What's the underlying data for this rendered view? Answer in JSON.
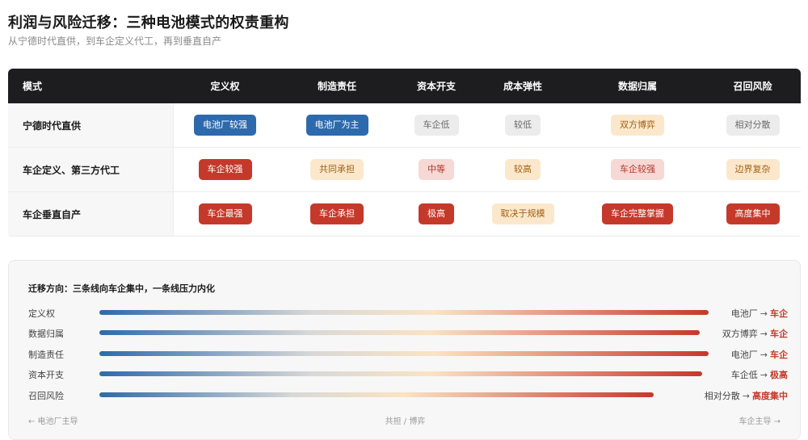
{
  "header": {
    "title": "利润与风险迁移：三种电池模式的权责重构",
    "subtitle": "从宁德时代直供，到车企定义代工，再到垂直自产"
  },
  "matrix": {
    "columns": [
      "模式",
      "定义权",
      "制造责任",
      "资本开支",
      "成本弹性",
      "数据归属",
      "召回风险"
    ],
    "rows": [
      {
        "label": "宁德时代直供",
        "cells": [
          {
            "text": "电池厂较强",
            "tone": "strong-blue"
          },
          {
            "text": "电池厂为主",
            "tone": "strong-blue"
          },
          {
            "text": "车企低",
            "tone": "soft-gray"
          },
          {
            "text": "较低",
            "tone": "soft-gray"
          },
          {
            "text": "双方博弈",
            "tone": "soft-amber"
          },
          {
            "text": "相对分散",
            "tone": "soft-gray"
          }
        ]
      },
      {
        "label": "车企定义、第三方代工",
        "cells": [
          {
            "text": "车企较强",
            "tone": "strong-red"
          },
          {
            "text": "共同承担",
            "tone": "soft-amber"
          },
          {
            "text": "中等",
            "tone": "soft-red"
          },
          {
            "text": "较高",
            "tone": "soft-amber"
          },
          {
            "text": "车企较强",
            "tone": "soft-red"
          },
          {
            "text": "边界复杂",
            "tone": "soft-amber"
          }
        ]
      },
      {
        "label": "车企垂直自产",
        "cells": [
          {
            "text": "车企最强",
            "tone": "strong-red"
          },
          {
            "text": "车企承担",
            "tone": "strong-red"
          },
          {
            "text": "极高",
            "tone": "strong-red"
          },
          {
            "text": "取决于规模",
            "tone": "soft-amber"
          },
          {
            "text": "车企完整掌握",
            "tone": "strong-red"
          },
          {
            "text": "高度集中",
            "tone": "strong-red"
          }
        ]
      }
    ]
  },
  "migration": {
    "title": "迁移方向：三条线向车企集中，一条线压力内化",
    "rows": [
      {
        "label": "定义权",
        "from": "电池厂",
        "to": "车企",
        "level": 1.0
      },
      {
        "label": "数据归属",
        "from": "双方博弈",
        "to": "车企",
        "level": 0.985
      },
      {
        "label": "制造责任",
        "from": "电池厂",
        "to": "车企",
        "level": 1.0
      },
      {
        "label": "资本开支",
        "from": "车企低",
        "to": "极高",
        "level": 0.99
      },
      {
        "label": "召回风险",
        "from": "相对分散",
        "to": "高度集中",
        "level": 0.91
      }
    ],
    "arrow": "→",
    "axis": {
      "left": "← 电池厂主导",
      "center": "共担 / 博弈",
      "right": "车企主导 →"
    }
  },
  "colors": {
    "header_bg": "#1d1d1f",
    "blue": "#2d6aad",
    "red": "#c5392b",
    "amber": "#fbe8cc",
    "gradient": [
      "#2d6aad",
      "#d8d8d6",
      "#fbe3c3",
      "#c5392b"
    ]
  }
}
